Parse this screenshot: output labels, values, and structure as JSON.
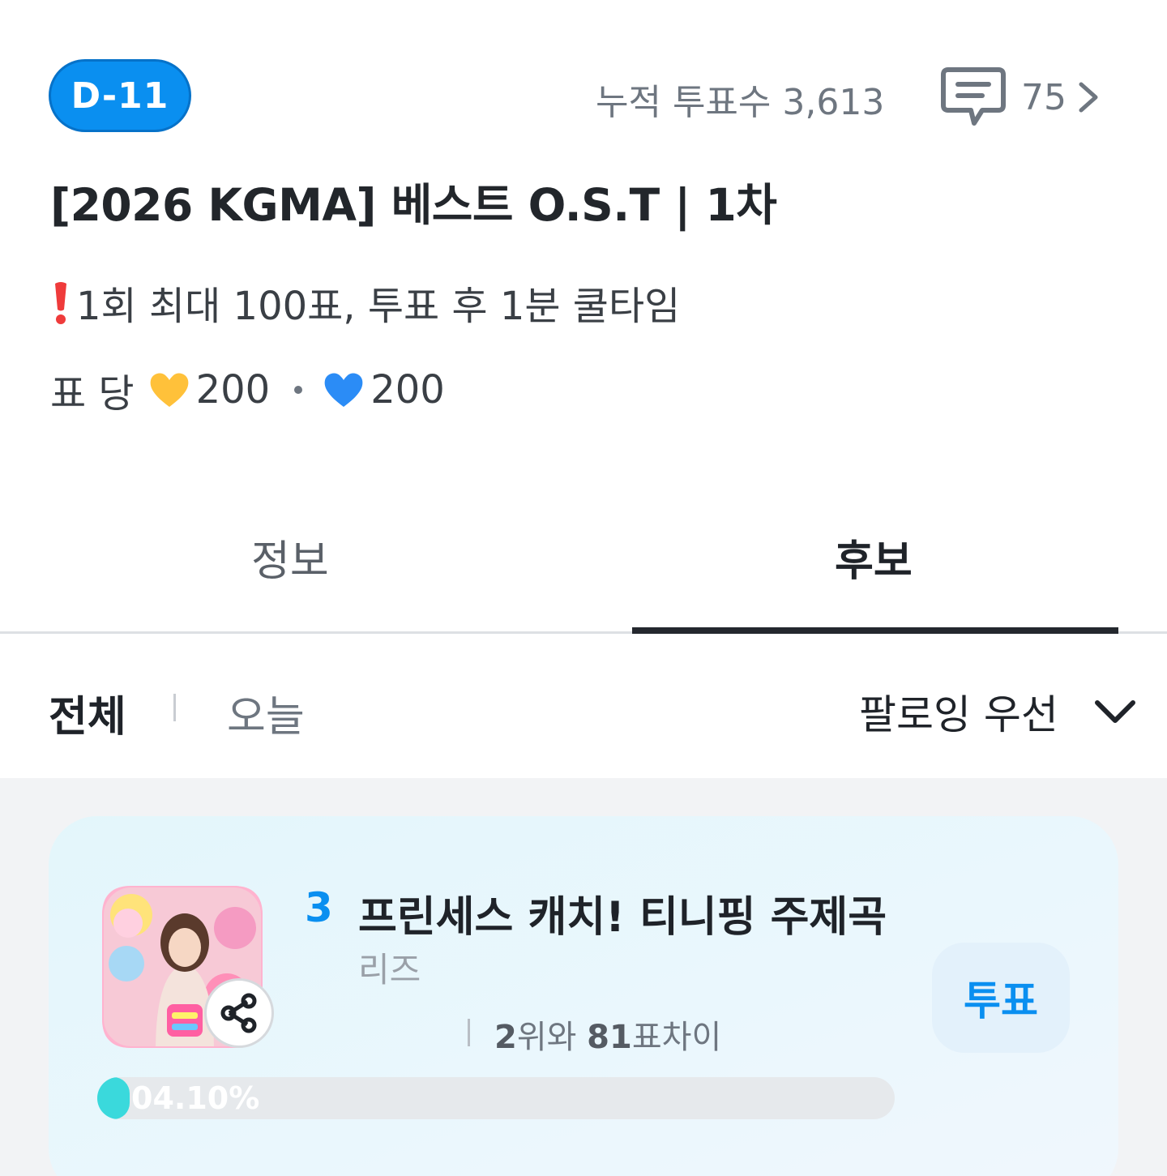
{
  "header": {
    "dday_badge": "D-11",
    "total_votes_text": "누적 투표수 3,613",
    "comment_count": "75"
  },
  "vote_title": "[2026 KGMA] 베스트 O.S.T | 1차",
  "notice_text": "1회 최대 100표, 투표 후 1분 쿨타임",
  "cost": {
    "label": "표 당",
    "gold_heart_amount": "200",
    "blue_heart_amount": "200",
    "gold_heart_color": "#FFC13A",
    "blue_heart_color": "#2B8CF6"
  },
  "tabs": [
    {
      "label": "정보",
      "active": false
    },
    {
      "label": "후보",
      "active": true
    }
  ],
  "filters": {
    "all_label": "전체",
    "today_label": "오늘",
    "sort_label": "팔로잉 우선"
  },
  "candidates": [
    {
      "rank": "3",
      "title": "프린세스 캐치! 티니핑 주제곡",
      "artist": "리즈",
      "gap_rank": "2",
      "gap_mid": "위와",
      "gap_votes": "81",
      "gap_suffix": "표차이",
      "vote_button": "투표",
      "percent_label": "04.10%",
      "percent_value": 4.1
    }
  ],
  "colors": {
    "accent": "#0A8FF0",
    "progress": "#3AD9DC",
    "card_bg": "#E6F6FC"
  }
}
